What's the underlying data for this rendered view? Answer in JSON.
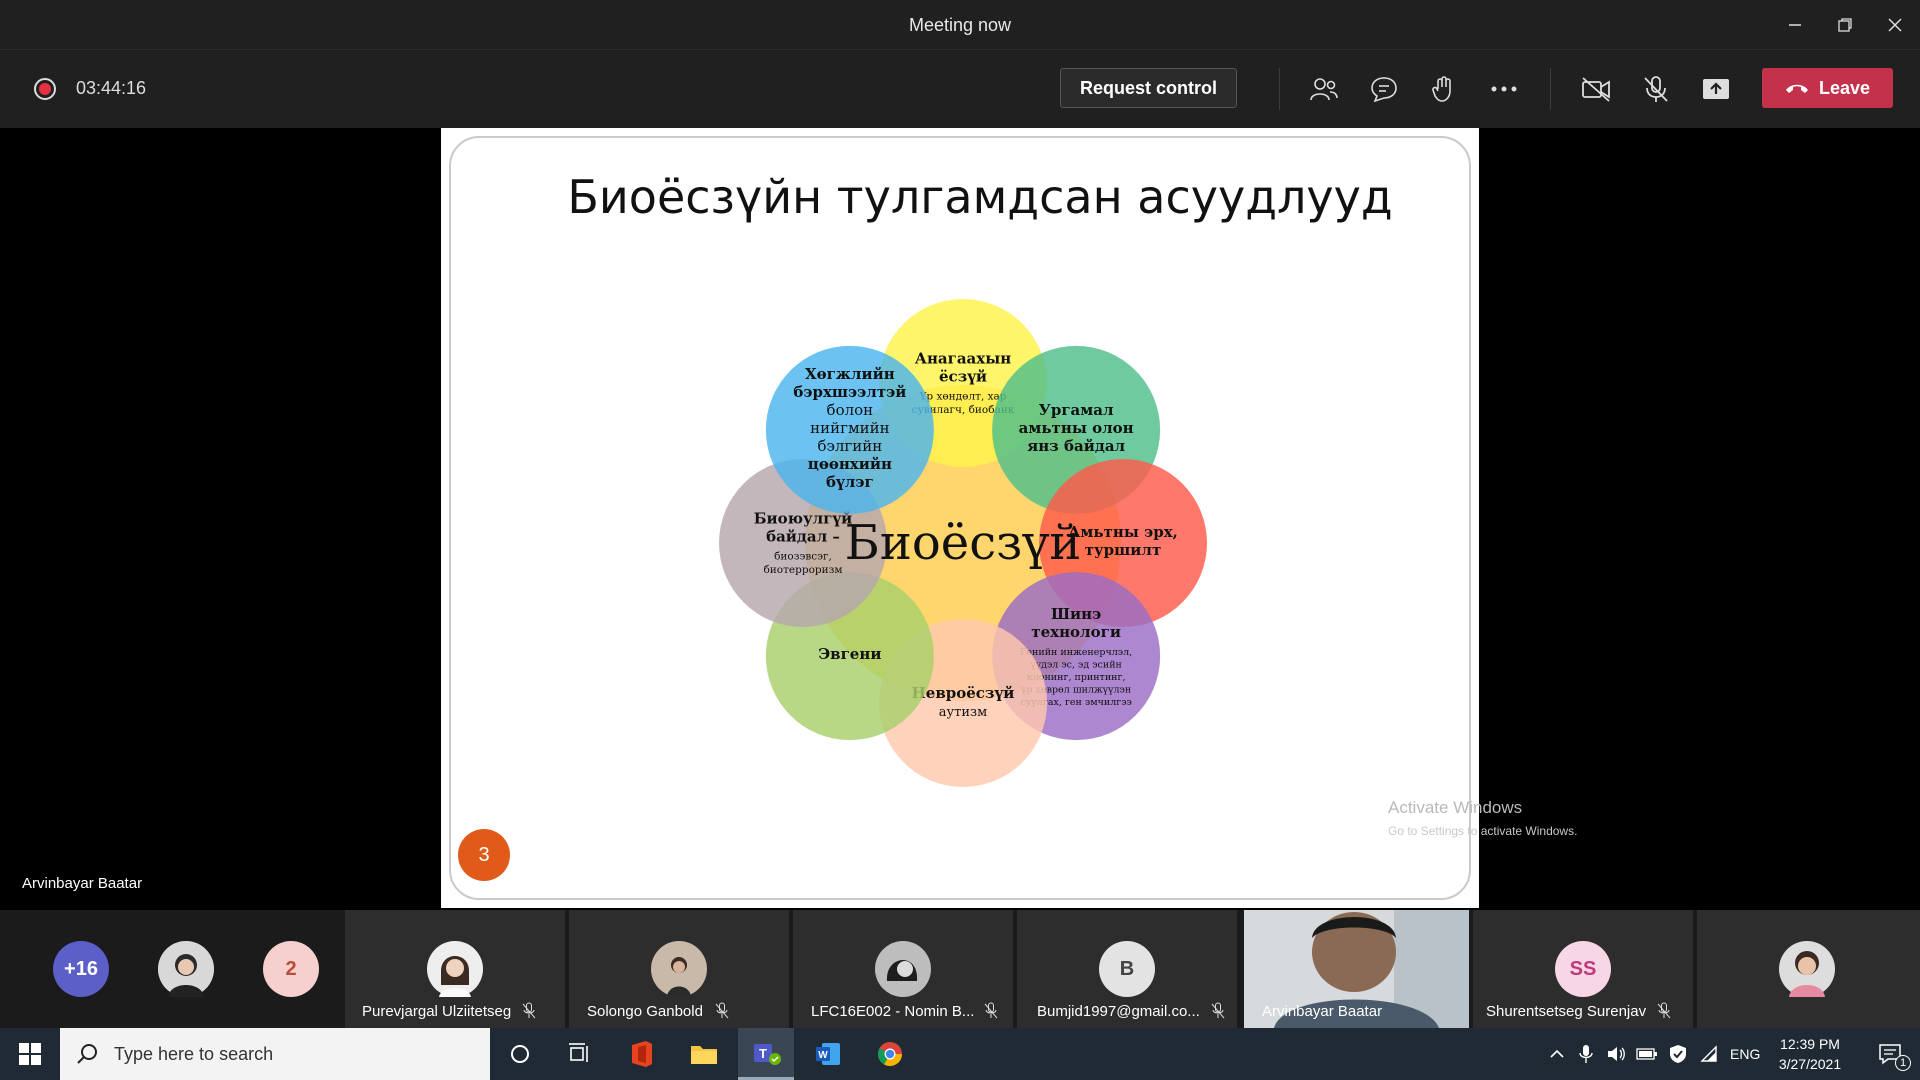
{
  "window": {
    "title": "Meeting now"
  },
  "toolbar": {
    "timer": "03:44:16",
    "request_control": "Request control",
    "leave": "Leave"
  },
  "stage": {
    "presenter_name": "Arvinbayar Baatar",
    "watermark_line1": "Activate Windows",
    "watermark_line2": "Go to Settings to activate Windows."
  },
  "slide": {
    "title": "Биоёсзүйн тулгамдсан асуудлууд",
    "center": "Биоёсзүй",
    "number": "3",
    "petals": [
      {
        "id": "medical",
        "color": "#fff34a",
        "lines_bold": [
          "Анагаахын",
          "ёсзүй"
        ],
        "lines_small": [
          "Үр хөндөлт, хар",
          "сувилагч, биобанк"
        ]
      },
      {
        "id": "biodiversity",
        "color": "#4fbf8a",
        "lines_bold": [
          "Ургамал",
          "амьтны олон",
          "янз байдал"
        ],
        "lines_small": []
      },
      {
        "id": "animals",
        "color": "#ff5a4a",
        "lines_bold": [
          "Амьтны эрх,",
          "туршилт"
        ],
        "lines_small": []
      },
      {
        "id": "tech",
        "color": "#9b6cc4",
        "lines_bold": [
          "Шинэ",
          "технологи"
        ],
        "lines_small": [
          "Генийн инженерчлэл,",
          "үүдэл эс, эд эсийн",
          "клонинг, принтинг,",
          "үр хөврөл шилжүүлэн",
          "суулгах, ген эмчилгээ"
        ]
      },
      {
        "id": "neuro",
        "color": "#ffc8ad",
        "lines_bold": [
          "Невроёсзүй"
        ],
        "lines_small": [
          "аутизм"
        ]
      },
      {
        "id": "aging",
        "color": "#a8cf6a",
        "lines_bold": [
          "Эвгени"
        ],
        "lines_small": []
      },
      {
        "id": "biosecurity",
        "color": "#b6a7ad",
        "lines_bold": [
          "Биоюулгүй",
          "байдал –"
        ],
        "lines_small": [
          "биозэвсэг,",
          "биотерроризм"
        ]
      },
      {
        "id": "disability",
        "color": "#4cb4ee",
        "lines_bold": [
          "Хөгжлийн",
          "бэрхшээлтэй"
        ],
        "lines_mid": [
          "болон",
          "нийгмийн",
          "бэлгийн"
        ],
        "lines_bold2": [
          "цөөнхийн",
          "бүлэг"
        ]
      }
    ]
  },
  "participants": {
    "overflow": "+16",
    "count_badge": "2",
    "tiles": [
      {
        "name": "Purevjargal Ulziitetseg"
      },
      {
        "name": "Solongo Ganbold"
      },
      {
        "name": "LFC16E002 - Nomin B..."
      },
      {
        "name": "Bumjid1997@gmail.co...",
        "initial": "B"
      },
      {
        "name": "Arvinbayar Baatar"
      },
      {
        "name": "Shurentsetseg Surenjav",
        "initial": "SS"
      }
    ]
  },
  "taskbar": {
    "search_placeholder": "Type here to search",
    "lang": "ENG",
    "time": "12:39 PM",
    "date": "3/27/2021",
    "notif_count": "1"
  }
}
